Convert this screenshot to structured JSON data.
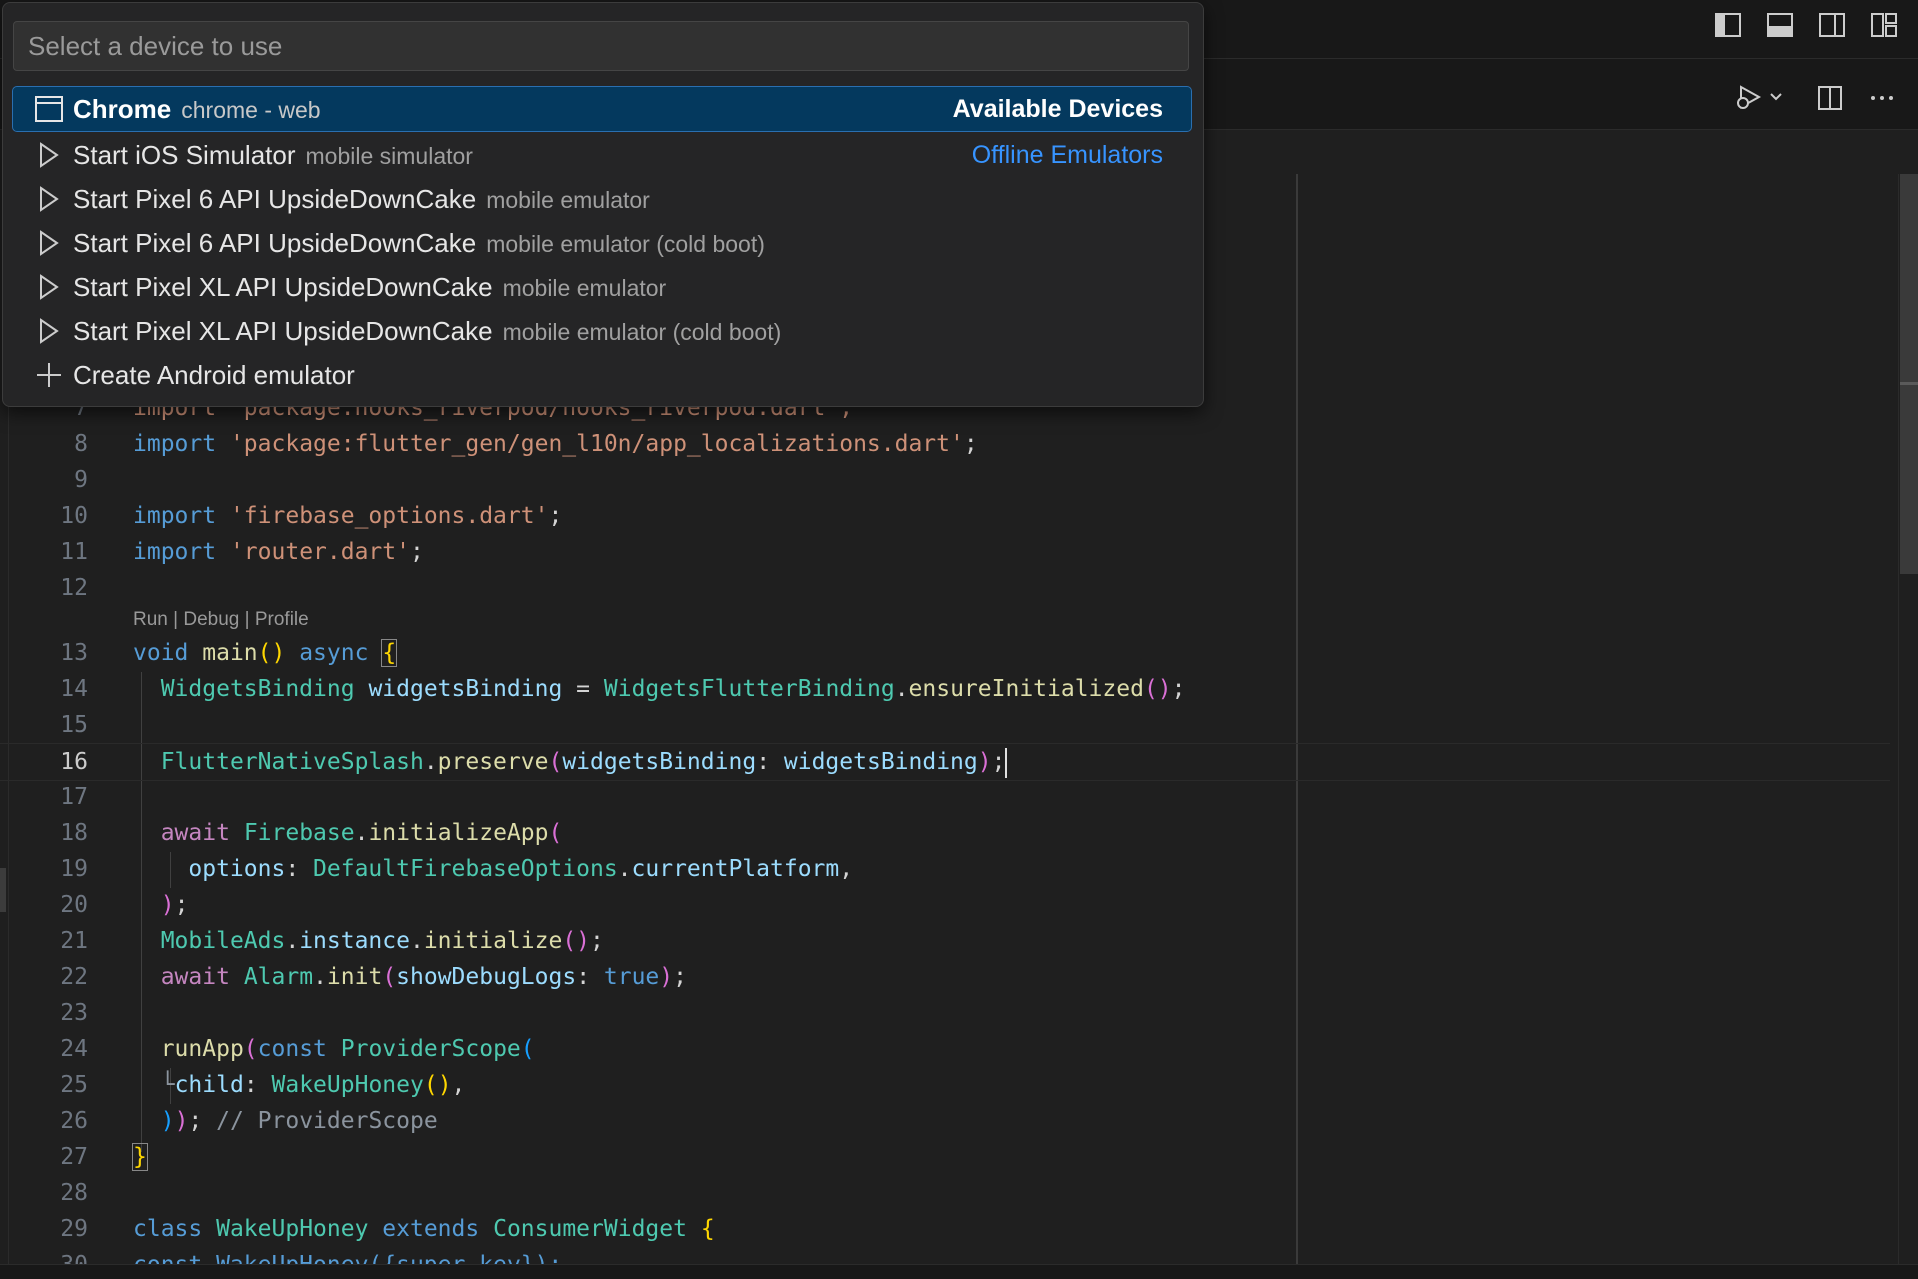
{
  "device_picker": {
    "placeholder": "Select a device to use",
    "items": [
      {
        "icon": "browser-window-icon",
        "label": "Chrome",
        "description": "chrome - web",
        "group": "Available Devices",
        "selected": true
      },
      {
        "icon": "play-icon",
        "label": "Start iOS Simulator",
        "description": "mobile simulator",
        "group": "Offline Emulators"
      },
      {
        "icon": "play-icon",
        "label": "Start Pixel 6 API UpsideDownCake",
        "description": "mobile emulator"
      },
      {
        "icon": "play-icon",
        "label": "Start Pixel 6 API UpsideDownCake",
        "description": "mobile emulator (cold boot)"
      },
      {
        "icon": "play-icon",
        "label": "Start Pixel XL API UpsideDownCake",
        "description": "mobile emulator"
      },
      {
        "icon": "play-icon",
        "label": "Start Pixel XL API UpsideDownCake",
        "description": "mobile emulator (cold boot)"
      },
      {
        "icon": "plus-icon",
        "label": "Create Android emulator",
        "description": ""
      }
    ]
  },
  "editor": {
    "codelens": {
      "run": "Run",
      "debug": "Debug",
      "profile": "Profile",
      "separator": " | "
    },
    "line_numbers": [
      "7",
      "8",
      "9",
      "10",
      "11",
      "12",
      "13",
      "14",
      "15",
      "16",
      "17",
      "18",
      "19",
      "20",
      "21",
      "22",
      "23",
      "24",
      "25",
      "26",
      "27",
      "28",
      "29",
      "30"
    ],
    "lines": {
      "l7": "import 'package:hooks_riverpod/hooks_riverpod.dart';",
      "l8_kw": "import",
      "l8_str": "'package:flutter_gen/gen_l10n/app_localizations.dart'",
      "l10_kw": "import",
      "l10_str": "'firebase_options.dart'",
      "l11_kw": "import",
      "l11_str": "'router.dart'",
      "l13": {
        "void": "void",
        "main": "main",
        "async": "async"
      },
      "l14": {
        "type1": "WidgetsBinding",
        "var": "widgetsBinding",
        "type2": "WidgetsFlutterBinding",
        "fn": "ensureInitialized"
      },
      "l16": {
        "type": "FlutterNativeSplash",
        "fn": "preserve",
        "param": "widgetsBinding",
        "arg": "widgetsBinding"
      },
      "l18": {
        "await": "await",
        "type": "Firebase",
        "fn": "initializeApp"
      },
      "l19": {
        "param": "options",
        "type": "DefaultFirebaseOptions",
        "prop": "currentPlatform"
      },
      "l21": {
        "type": "MobileAds",
        "prop": "instance",
        "fn": "initialize"
      },
      "l22": {
        "await": "await",
        "type": "Alarm",
        "fn": "init",
        "param": "showDebugLogs",
        "val": "true"
      },
      "l24": {
        "fn": "runApp",
        "const": "const",
        "type": "ProviderScope"
      },
      "l25": {
        "param": "child",
        "type": "WakeUpHoney"
      },
      "l26": {
        "comment": "// ProviderScope"
      },
      "l29": {
        "class": "class",
        "name": "WakeUpHoney",
        "extends": "extends",
        "base": "ConsumerWidget"
      },
      "l30": "const WakeUpHoney({super.key});"
    },
    "active_line": "16"
  }
}
